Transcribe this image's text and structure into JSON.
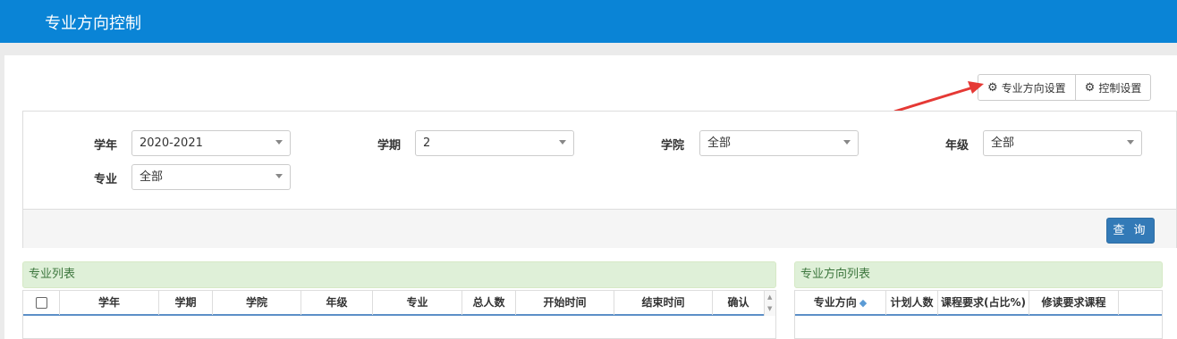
{
  "header": {
    "title": "专业方向控制"
  },
  "toolbar": {
    "direction_settings": "专业方向设置",
    "control_settings": "控制设置"
  },
  "filters": {
    "year_label": "学年",
    "year_value": "2020-2021",
    "term_label": "学期",
    "term_value": "2",
    "college_label": "学院",
    "college_value": "全部",
    "grade_label": "年级",
    "grade_value": "全部",
    "major_label": "专业",
    "major_value": "全部",
    "query_button": "查 询"
  },
  "major_list": {
    "title": "专业列表",
    "columns": [
      "学年",
      "学期",
      "学院",
      "年级",
      "专业",
      "总人数",
      "开始时间",
      "结束时间",
      "确认"
    ]
  },
  "direction_list": {
    "title": "专业方向列表",
    "columns": [
      "专业方向",
      "计划人数",
      "课程要求(占比%)",
      "修读要求课程"
    ]
  },
  "colors": {
    "header_bg": "#0a84d6",
    "query_button_bg": "#337ab7",
    "list_header_bg": "#dff0d8",
    "annotation_arrow": "#e53935"
  }
}
